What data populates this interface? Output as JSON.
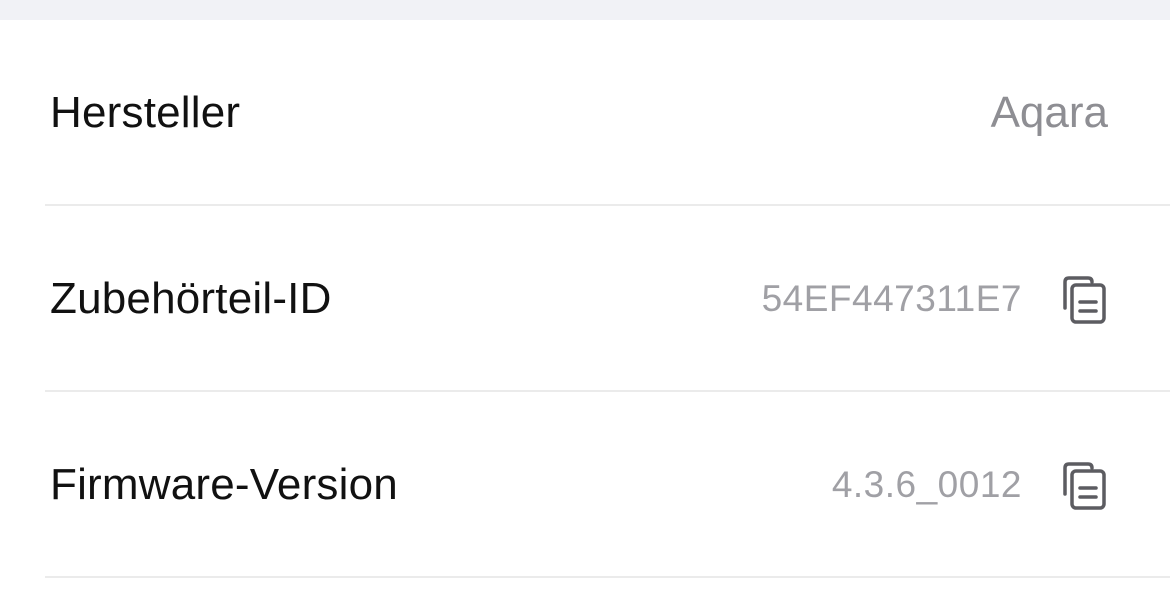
{
  "details": {
    "rows": [
      {
        "label": "Hersteller",
        "value": "Aqara"
      },
      {
        "label": "Zubehörteil-ID",
        "value": "54EF447311E7",
        "copy_icon": "copy-icon"
      },
      {
        "label": "Firmware-Version",
        "value": "4.3.6_0012",
        "copy_icon": "copy-icon"
      }
    ]
  },
  "colors": {
    "label": "#111111",
    "value": "#8e8e93",
    "divider": "#ebebeb",
    "top_band": "#f1f2f6",
    "icon": "#5c5c61"
  }
}
